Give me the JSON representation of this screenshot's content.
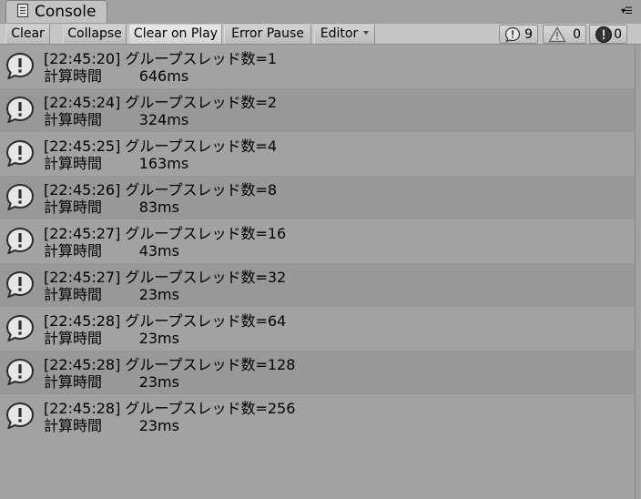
{
  "window": {
    "tab_title": "Console"
  },
  "toolbar": {
    "clear": "Clear",
    "collapse": "Collapse",
    "clear_on_play": "Clear on Play",
    "error_pause": "Error Pause",
    "editor": "Editor",
    "log_count": "9",
    "warning_count": "0",
    "error_count": "0"
  },
  "entries": [
    {
      "header": "[22:45:20] グループスレッド数=1",
      "detail": "計算時間        646ms"
    },
    {
      "header": "[22:45:24] グループスレッド数=2",
      "detail": "計算時間        324ms"
    },
    {
      "header": "[22:45:25] グループスレッド数=4",
      "detail": "計算時間        163ms"
    },
    {
      "header": "[22:45:26] グループスレッド数=8",
      "detail": "計算時間        83ms"
    },
    {
      "header": "[22:45:27] グループスレッド数=16",
      "detail": "計算時間        43ms"
    },
    {
      "header": "[22:45:27] グループスレッド数=32",
      "detail": "計算時間        23ms"
    },
    {
      "header": "[22:45:28] グループスレッド数=64",
      "detail": "計算時間        23ms"
    },
    {
      "header": "[22:45:28] グループスレッド数=128",
      "detail": "計算時間        23ms"
    },
    {
      "header": "[22:45:28] グループスレッド数=256",
      "detail": "計算時間        23ms"
    }
  ]
}
